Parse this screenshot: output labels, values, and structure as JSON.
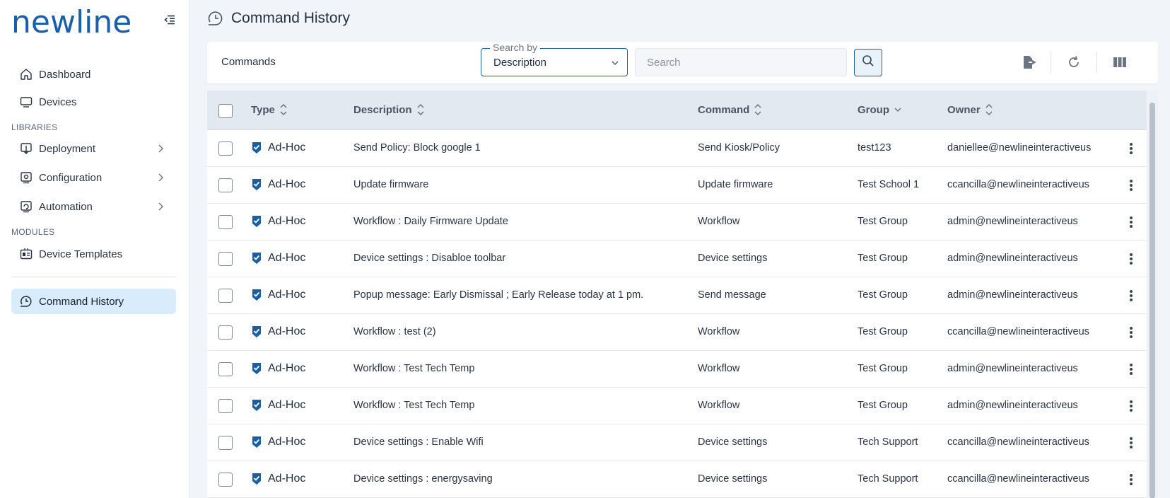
{
  "brand": {
    "logo_text": "newline",
    "color": "#1a5fa8"
  },
  "sidebar": {
    "collapse_icon": "collapse-menu-icon",
    "items": [
      {
        "label": "Dashboard",
        "icon": "home-icon"
      },
      {
        "label": "Devices",
        "icon": "monitor-icon"
      }
    ],
    "libraries_label": "LIBRARIES",
    "libraries": [
      {
        "label": "Deployment",
        "icon": "deployment-icon"
      },
      {
        "label": "Configuration",
        "icon": "configuration-icon"
      },
      {
        "label": "Automation",
        "icon": "automation-icon"
      }
    ],
    "modules_label": "MODULES",
    "modules": [
      {
        "label": "Device Templates",
        "icon": "template-icon"
      }
    ],
    "active_item": {
      "label": "Command History",
      "icon": "command-history-icon"
    },
    "active_bg": "#d9ecfb"
  },
  "page": {
    "title": "Command History"
  },
  "toolbar": {
    "label": "Commands",
    "search_by_legend": "Search by",
    "search_by_value": "Description",
    "search_placeholder": "Search",
    "search_value": ""
  },
  "table": {
    "columns": {
      "type": "Type",
      "description": "Description",
      "command": "Command",
      "group": "Group",
      "owner": "Owner"
    },
    "rows": [
      {
        "type": "Ad-Hoc",
        "description": "Send Policy: Block google 1",
        "command": "Send Kiosk/Policy",
        "group": "test123",
        "owner": "daniellee@newlineinteractiveus"
      },
      {
        "type": "Ad-Hoc",
        "description": "Update firmware",
        "command": "Update firmware",
        "group": "Test School 1",
        "owner": "ccancilla@newlineinteractiveus"
      },
      {
        "type": "Ad-Hoc",
        "description": "Workflow : Daily Firmware Update",
        "command": "Workflow",
        "group": "Test Group",
        "owner": "admin@newlineinteractiveus"
      },
      {
        "type": "Ad-Hoc",
        "description": "Device settings : Disabloe toolbar",
        "command": "Device settings",
        "group": "Test Group",
        "owner": "admin@newlineinteractiveus"
      },
      {
        "type": "Ad-Hoc",
        "description": "Popup message: Early Dismissal ; Early Release today at 1 pm.",
        "command": "Send message",
        "group": "Test Group",
        "owner": "admin@newlineinteractiveus"
      },
      {
        "type": "Ad-Hoc",
        "description": "Workflow : test (2)",
        "command": "Workflow",
        "group": "Test Group",
        "owner": "ccancilla@newlineinteractiveus"
      },
      {
        "type": "Ad-Hoc",
        "description": "Workflow : Test Tech Temp",
        "command": "Workflow",
        "group": "Test Group",
        "owner": "admin@newlineinteractiveus"
      },
      {
        "type": "Ad-Hoc",
        "description": "Workflow : Test Tech Temp",
        "command": "Workflow",
        "group": "Test Group",
        "owner": "admin@newlineinteractiveus"
      },
      {
        "type": "Ad-Hoc",
        "description": "Device settings : Enable Wifi",
        "command": "Device settings",
        "group": "Tech Support",
        "owner": "ccancilla@newlineinteractiveus"
      },
      {
        "type": "Ad-Hoc",
        "description": "Device settings : energysaving",
        "command": "Device settings",
        "group": "Tech Support",
        "owner": "ccancilla@newlineinteractiveus"
      }
    ]
  },
  "colors": {
    "accent": "#1b5fa3",
    "header_bg": "#e3e9f1",
    "page_bg": "#f1f4f8"
  }
}
